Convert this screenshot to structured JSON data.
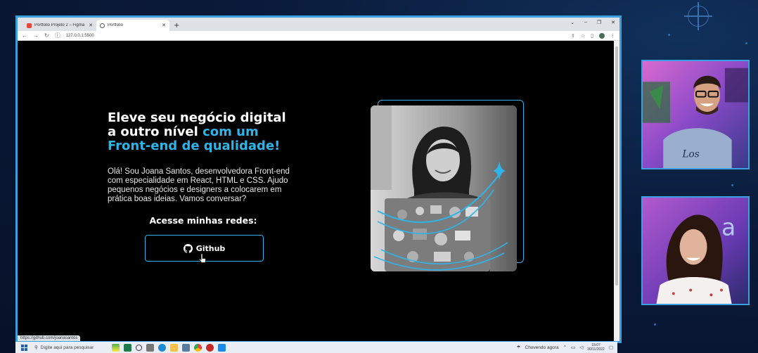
{
  "browser": {
    "tabs": [
      {
        "title": "Portfolio Projeto 2 – Figma",
        "icon": "figma-icon",
        "active": false
      },
      {
        "title": "Portfolio",
        "icon": "globe-icon",
        "active": true
      }
    ],
    "new_tab": "+",
    "url": "127.0.0.1:5500",
    "status_link": "https://github.com/joanasantos"
  },
  "page": {
    "title_line1": "Eleve seu negócio digital",
    "title_line2_plain": "a outro nível ",
    "title_line2_highlight": "com um",
    "title_line3": "Front-end de qualidade!",
    "intro": "Olá! Sou Joana Santos, desenvolvedora Front-end com especialidade em React, HTML e CSS. Ajudo pequenos negócios e designers a colocarem em prática boas ideias. Vamos conversar?",
    "social_title": "Acesse minhas redes:",
    "github_label": "Github",
    "accent_color": "#2fb4e9"
  },
  "taskbar": {
    "search_placeholder": "Digite aqui para pesquisar",
    "weather": "Chovendo agora",
    "time": "15:07",
    "date": "30/11/2022"
  }
}
